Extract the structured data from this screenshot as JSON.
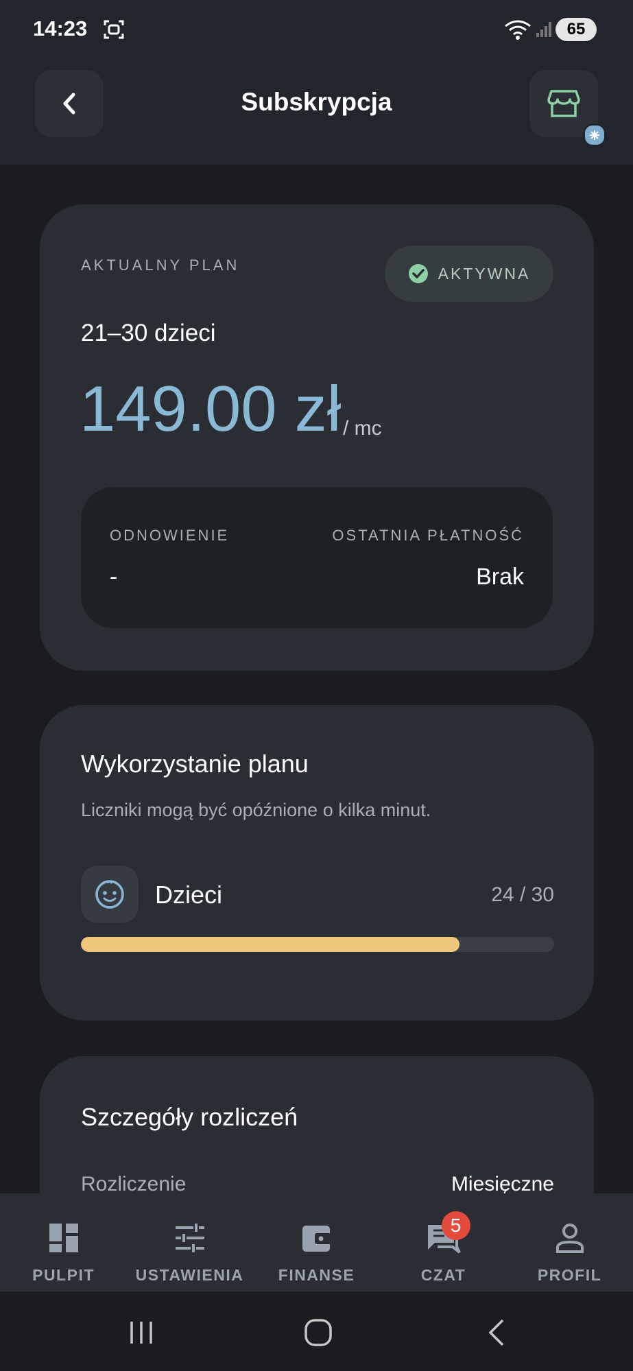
{
  "status_bar": {
    "time": "14:23",
    "battery": "65"
  },
  "header": {
    "title": "Subskrypcja"
  },
  "plan": {
    "label": "AKTUALNY PLAN",
    "status": "AKTYWNA",
    "name": "21–30 dzieci",
    "price": "149.00 zł",
    "period": "/ mc",
    "renewal_label": "ODNOWIENIE",
    "renewal_value": "-",
    "last_payment_label": "OSTATNIA PŁATNOŚĆ",
    "last_payment_value": "Brak"
  },
  "usage": {
    "title": "Wykorzystanie planu",
    "note": "Liczniki mogą być opóźnione o kilka minut.",
    "items": [
      {
        "label": "Dzieci",
        "count_text": "24 / 30",
        "used": 24,
        "limit": 30
      }
    ]
  },
  "billing": {
    "title": "Szczegóły rozliczeń",
    "rows": [
      {
        "key": "Rozliczenie",
        "value": "Miesięczne"
      }
    ]
  },
  "bottom_nav": {
    "items": [
      {
        "label": "PULPIT",
        "icon": "dashboard-icon"
      },
      {
        "label": "USTAWIENIA",
        "icon": "sliders-icon"
      },
      {
        "label": "FINANSE",
        "icon": "wallet-icon"
      },
      {
        "label": "CZAT",
        "icon": "chat-icon",
        "badge": "5"
      },
      {
        "label": "PROFIL",
        "icon": "person-icon"
      }
    ]
  },
  "colors": {
    "accent_price": "#8bb8d4",
    "progress": "#eec77d",
    "active_green": "#8ecfa6",
    "badge_red": "#e54b3c"
  }
}
